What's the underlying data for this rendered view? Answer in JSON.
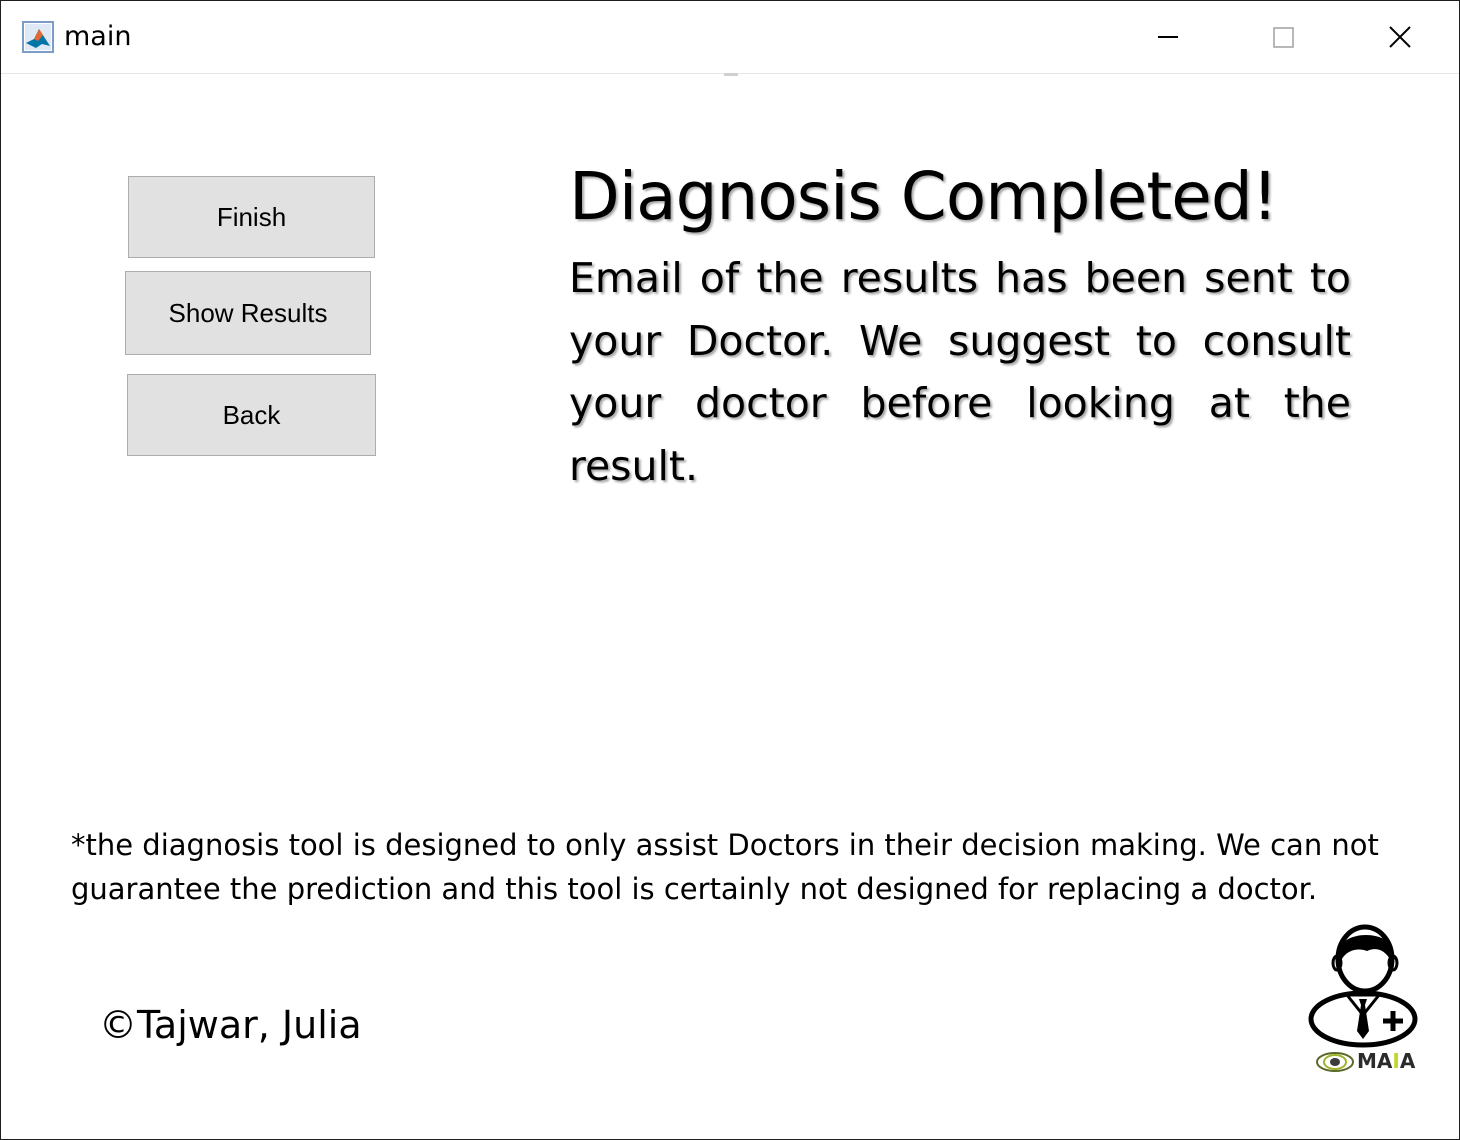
{
  "window": {
    "title": "main",
    "controls": {
      "minimize": "minimize-icon",
      "maximize": "maximize-icon",
      "close": "close-icon"
    }
  },
  "actions": {
    "finish_label": "Finish",
    "show_results_label": "Show Results",
    "back_label": "Back"
  },
  "main": {
    "heading": "Diagnosis Completed!",
    "message": "Email of the results has been sent to your Doctor. We suggest to consult your doctor before looking at the result."
  },
  "disclaimer": "*the diagnosis tool is designed to only assist Doctors in their decision making. We can not guarantee the prediction and this tool is certainly not designed for replacing a doctor.",
  "footer": {
    "copyright": "©Tajwar, Julia",
    "logo": {
      "icon": "doctor-plus-icon",
      "brand_prefix": "MA",
      "brand_accent": "I",
      "brand_suffix": "A",
      "accent_color": "#c2d62e"
    }
  },
  "colors": {
    "button_bg": "#e1e1e1",
    "button_border": "#adadad",
    "window_border": "#1f1f1f"
  }
}
